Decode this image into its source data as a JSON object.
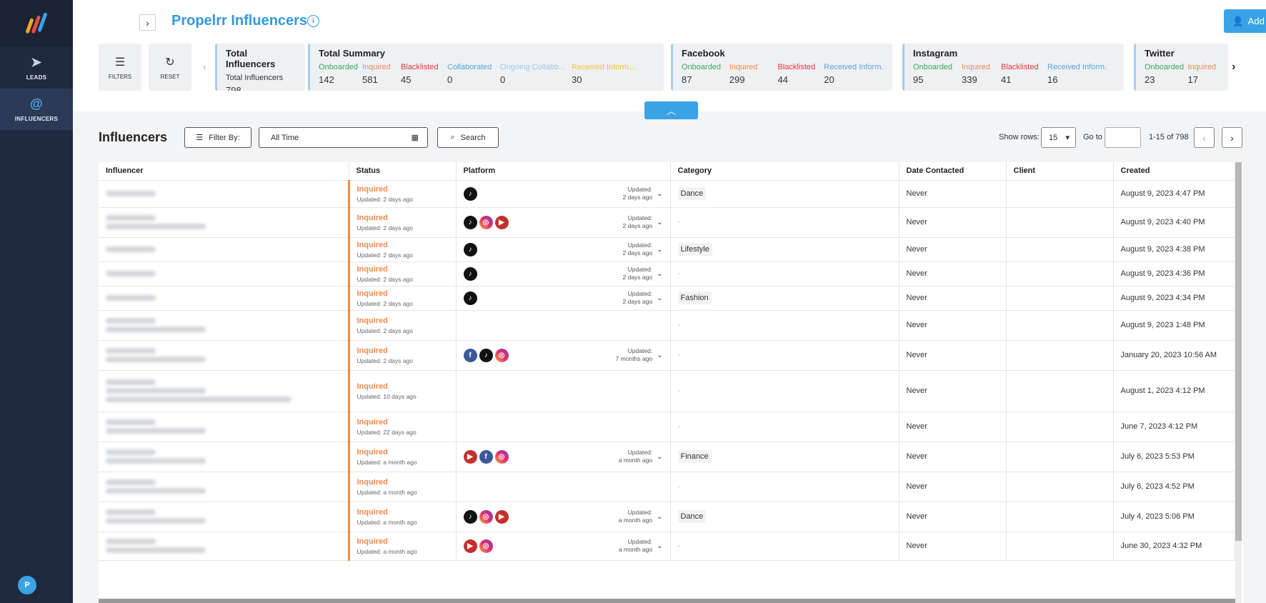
{
  "app": {
    "title": "Propelrr Influencers",
    "add_button": "Add Influencer"
  },
  "sidebar": {
    "items": [
      {
        "label": "LEADS",
        "icon": "paper-plane-icon"
      },
      {
        "label": "INFLUENCERS",
        "icon": "at-icon"
      }
    ],
    "avatar": "P"
  },
  "toolbar": {
    "filters": "FILTERS",
    "reset": "RESET"
  },
  "cards": [
    {
      "title": "Total Influencers",
      "stats": [
        {
          "label": "Total Influencers",
          "value": "798",
          "color": "dark"
        }
      ]
    },
    {
      "title": "Total Summary",
      "stats": [
        {
          "label": "Onboarded",
          "value": "142",
          "color": "green"
        },
        {
          "label": "Inquired",
          "value": "581",
          "color": "orange"
        },
        {
          "label": "Blacklisted",
          "value": "45",
          "color": "red"
        },
        {
          "label": "Collaborated",
          "value": "0",
          "color": "blue"
        },
        {
          "label": "Ongoing Collabo...",
          "value": "0",
          "color": "lblue"
        },
        {
          "label": "Received Inform...",
          "value": "30",
          "color": "yellow"
        }
      ]
    },
    {
      "title": "Facebook",
      "stats": [
        {
          "label": "Onboarded",
          "value": "87",
          "color": "green"
        },
        {
          "label": "Inquired",
          "value": "299",
          "color": "orange"
        },
        {
          "label": "Blacklisted",
          "value": "44",
          "color": "red"
        },
        {
          "label": "Received Inform...",
          "value": "20",
          "color": "blue"
        }
      ]
    },
    {
      "title": "Instagram",
      "stats": [
        {
          "label": "Onboarded",
          "value": "95",
          "color": "green"
        },
        {
          "label": "Inquired",
          "value": "339",
          "color": "orange"
        },
        {
          "label": "Blacklisted",
          "value": "41",
          "color": "red"
        },
        {
          "label": "Received Inform...",
          "value": "16",
          "color": "blue"
        }
      ]
    },
    {
      "title": "Twitter",
      "stats": [
        {
          "label": "Onboarded",
          "value": "23",
          "color": "green"
        },
        {
          "label": "Inquired",
          "value": "17",
          "color": "orange"
        }
      ]
    }
  ],
  "list": {
    "title": "Influencers",
    "filter_by": "Filter By:",
    "date_range": "All Time",
    "search": "Search",
    "show_rows_label": "Show rows:",
    "rows_value": "15",
    "goto_label": "Go to",
    "range": "1-15 of 798"
  },
  "table": {
    "headers": [
      "Influencer",
      "Status",
      "Platform",
      "Category",
      "Date Contacted",
      "Client",
      "Created"
    ],
    "rows": [
      {
        "blur_lines": 1,
        "status": "Inquired",
        "status_sub": "Updated: 2 days ago",
        "platforms": [
          "tiktok"
        ],
        "upd1": "Updated:",
        "upd2": "2 days ago",
        "category": "Dance",
        "contacted": "Never",
        "client": "",
        "created": "August 9, 2023 4:47 PM"
      },
      {
        "blur_lines": 2,
        "status": "Inquired",
        "status_sub": "Updated: 2 days ago",
        "platforms": [
          "tiktok",
          "instagram",
          "youtube"
        ],
        "upd1": "Updated:",
        "upd2": "2 days ago",
        "category": "",
        "contacted": "Never",
        "client": "",
        "created": "August 9, 2023 4:40 PM"
      },
      {
        "blur_lines": 1,
        "status": "Inquired",
        "status_sub": "Updated: 2 days ago",
        "platforms": [
          "tiktok"
        ],
        "upd1": "Updated:",
        "upd2": "2 days ago",
        "category": "Lifestyle",
        "contacted": "Never",
        "client": "",
        "created": "August 9, 2023 4:38 PM"
      },
      {
        "blur_lines": 1,
        "status": "Inquired",
        "status_sub": "Updated: 2 days ago",
        "platforms": [
          "tiktok"
        ],
        "upd1": "Updated:",
        "upd2": "2 days ago",
        "category": "",
        "contacted": "Never",
        "client": "",
        "created": "August 9, 2023 4:36 PM"
      },
      {
        "blur_lines": 1,
        "status": "Inquired",
        "status_sub": "Updated: 2 days ago",
        "platforms": [
          "tiktok"
        ],
        "upd1": "Updated:",
        "upd2": "2 days ago",
        "category": "Fashion",
        "contacted": "Never",
        "client": "",
        "created": "August 9, 2023 4:34 PM"
      },
      {
        "blur_lines": 2,
        "status": "Inquired",
        "status_sub": "Updated: 2 days ago",
        "platforms": [],
        "upd1": "",
        "upd2": "",
        "category": "",
        "contacted": "Never",
        "client": "",
        "created": "August 9, 2023 1:48 PM"
      },
      {
        "blur_lines": 2,
        "status": "Inquired",
        "status_sub": "Updated: 2 days ago",
        "platforms": [
          "facebook",
          "tiktok",
          "instagram"
        ],
        "upd1": "Updated:",
        "upd2": "7 months ago",
        "category": "",
        "contacted": "Never",
        "client": "",
        "created": "January 20, 2023 10:56 AM"
      },
      {
        "blur_lines": 3,
        "status": "Inquired",
        "status_sub": "Updated: 10 days ago",
        "platforms": [],
        "upd1": "",
        "upd2": "",
        "category": "",
        "contacted": "Never",
        "client": "",
        "created": "August 1, 2023 4:12 PM"
      },
      {
        "blur_lines": 2,
        "status": "Inquired",
        "status_sub": "Updated: 22 days ago",
        "platforms": [],
        "upd1": "",
        "upd2": "",
        "category": "",
        "contacted": "Never",
        "client": "",
        "created": "June 7, 2023 4:12 PM"
      },
      {
        "blur_lines": 2,
        "status": "Inquired",
        "status_sub": "Updated: a month ago",
        "platforms": [
          "youtube",
          "facebook",
          "instagram"
        ],
        "upd1": "Updated:",
        "upd2": "a month ago",
        "category": "Finance",
        "contacted": "Never",
        "client": "",
        "created": "July 6, 2023 5:53 PM"
      },
      {
        "blur_lines": 2,
        "status": "Inquired",
        "status_sub": "Updated: a month ago",
        "platforms": [],
        "upd1": "",
        "upd2": "",
        "category": "",
        "contacted": "Never",
        "client": "",
        "created": "July 6, 2023 4:52 PM"
      },
      {
        "blur_lines": 2,
        "status": "Inquired",
        "status_sub": "Updated: a month ago",
        "platforms": [
          "tiktok",
          "instagram",
          "youtube"
        ],
        "upd1": "Updated:",
        "upd2": "a month ago",
        "category": "Dance",
        "contacted": "Never",
        "client": "",
        "created": "July 4, 2023 5:06 PM"
      },
      {
        "blur_lines": 2,
        "status": "Inquired",
        "status_sub": "Updated: a month ago",
        "platforms": [
          "youtube",
          "instagram"
        ],
        "upd1": "Updated:",
        "upd2": "a month ago",
        "category": "",
        "contacted": "Never",
        "client": "",
        "created": "June 30, 2023 4:32 PM"
      }
    ]
  }
}
